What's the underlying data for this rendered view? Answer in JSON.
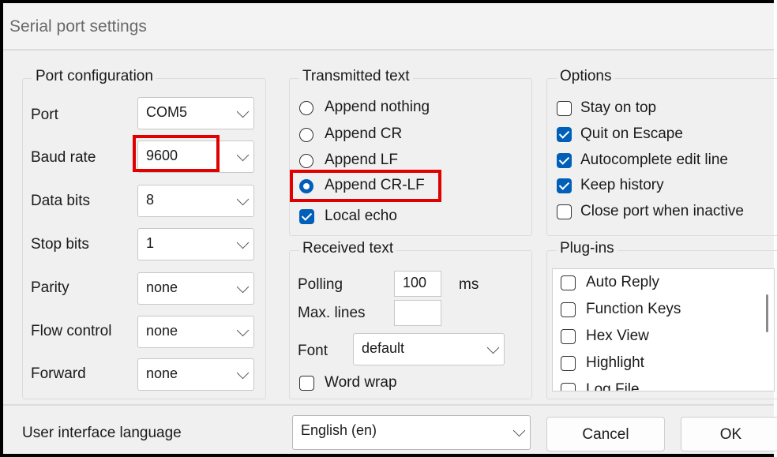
{
  "title": "Serial port settings",
  "port_config": {
    "legend": "Port configuration",
    "rows": [
      {
        "label": "Port",
        "value": "COM5"
      },
      {
        "label": "Baud rate",
        "value": "9600"
      },
      {
        "label": "Data bits",
        "value": "8"
      },
      {
        "label": "Stop bits",
        "value": "1"
      },
      {
        "label": "Parity",
        "value": "none"
      },
      {
        "label": "Flow control",
        "value": "none"
      },
      {
        "label": "Forward",
        "value": "none"
      }
    ]
  },
  "transmitted": {
    "legend": "Transmitted text",
    "options": [
      {
        "label": "Append nothing",
        "selected": false
      },
      {
        "label": "Append CR",
        "selected": false
      },
      {
        "label": "Append LF",
        "selected": false
      },
      {
        "label": "Append CR-LF",
        "selected": true
      }
    ],
    "local_echo": {
      "label": "Local echo",
      "checked": true
    }
  },
  "received": {
    "legend": "Received text",
    "polling_label": "Polling",
    "polling_value": "100",
    "polling_unit": "ms",
    "max_lines_label": "Max. lines",
    "max_lines_value": "",
    "font_label": "Font",
    "font_value": "default",
    "word_wrap": {
      "label": "Word wrap",
      "checked": false
    }
  },
  "options": {
    "legend": "Options",
    "items": [
      {
        "label": "Stay on top",
        "checked": false
      },
      {
        "label": "Quit on Escape",
        "checked": true
      },
      {
        "label": "Autocomplete edit line",
        "checked": true
      },
      {
        "label": "Keep history",
        "checked": true
      },
      {
        "label": "Close port when inactive",
        "checked": false
      }
    ]
  },
  "plugins": {
    "legend": "Plug-ins",
    "items": [
      {
        "label": "Auto Reply",
        "checked": false
      },
      {
        "label": "Function Keys",
        "checked": false
      },
      {
        "label": "Hex View",
        "checked": false
      },
      {
        "label": "Highlight",
        "checked": false
      },
      {
        "label": "Log File",
        "checked": false
      }
    ]
  },
  "footer": {
    "language_label": "User interface language",
    "language_value": "English (en)",
    "cancel_label": "Cancel",
    "ok_label": "OK"
  },
  "colors": {
    "accent": "#005fb8",
    "highlight": "#e00000"
  }
}
